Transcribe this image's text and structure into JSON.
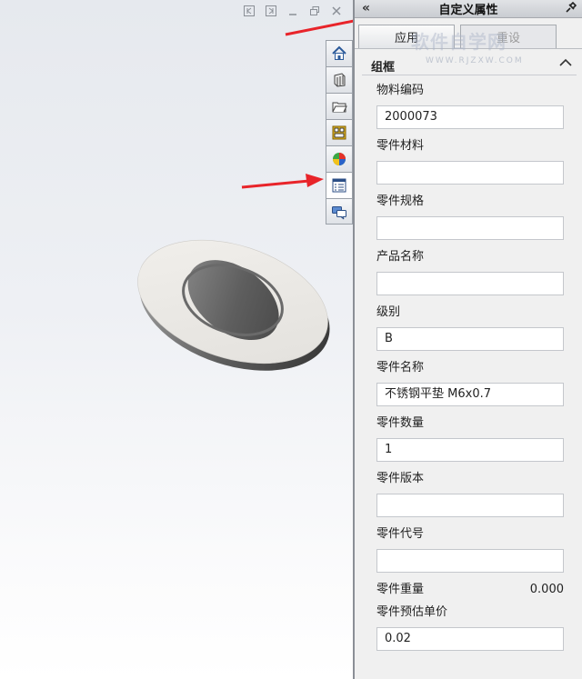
{
  "panel": {
    "title": "自定义属性",
    "collapse_glyph": "«",
    "apply_label": "应用",
    "reset_label": "重设",
    "group_title": "组框"
  },
  "watermark": {
    "text": "软件自学网",
    "sub": "WWW.RJZXW.COM"
  },
  "fields": [
    {
      "label": "物料编码",
      "value": "2000073"
    },
    {
      "label": "零件材料",
      "value": ""
    },
    {
      "label": "零件规格",
      "value": ""
    },
    {
      "label": "产品名称",
      "value": ""
    },
    {
      "label": "级别",
      "value": "B"
    },
    {
      "label": "零件名称",
      "value": "不锈钢平垫 M6x0.7"
    },
    {
      "label": "零件数量",
      "value": "1"
    },
    {
      "label": "零件版本",
      "value": ""
    },
    {
      "label": "零件代号",
      "value": ""
    }
  ],
  "weight": {
    "label": "零件重量",
    "value": "0.000"
  },
  "price": {
    "label": "零件预估单价",
    "value": "0.02"
  },
  "task_tabs": [
    "home-icon",
    "part-library-icon",
    "folder-icon",
    "view-palette-icon",
    "appearance-icon",
    "custom-properties-icon",
    "forum-icon"
  ],
  "colors": {
    "arrow": "#e8242a",
    "panel_bg": "#f0f0f0"
  }
}
